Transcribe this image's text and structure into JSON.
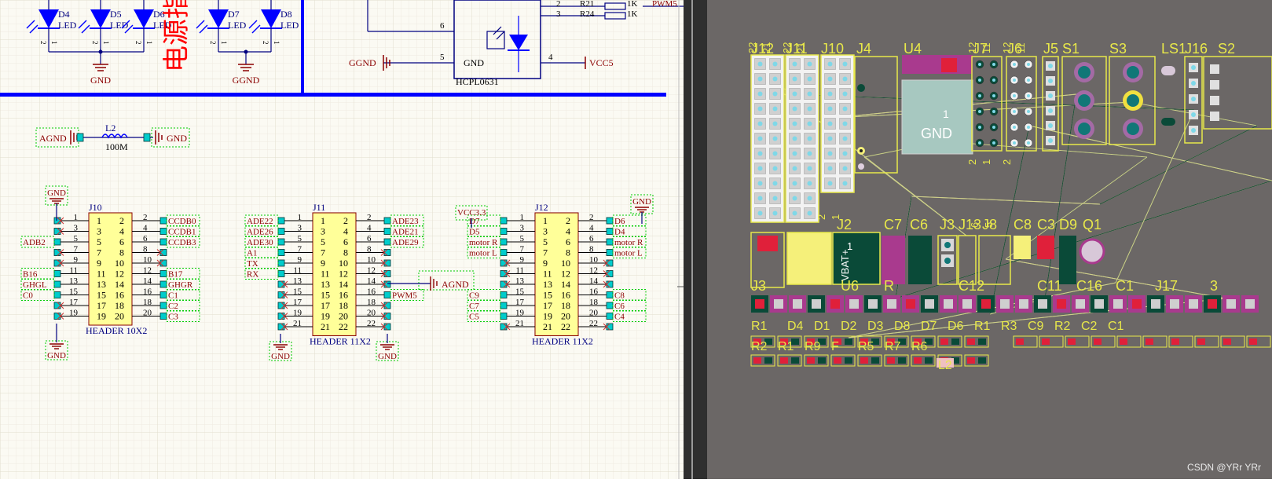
{
  "schematic": {
    "leds": [
      {
        "ref": "D4",
        "val": "LED"
      },
      {
        "ref": "D5",
        "val": "LED"
      },
      {
        "ref": "D6",
        "val": "LED"
      },
      {
        "ref": "D7",
        "val": "LED"
      },
      {
        "ref": "D8",
        "val": "LED"
      }
    ],
    "gnd_label_left": "GND",
    "ggnd_label_left": "GGND",
    "chinese_title": "电源指",
    "optocoupler": {
      "part": "HCPL0631",
      "pin6": "6",
      "pin5": "5",
      "pin4": "4",
      "pin2": "2",
      "pin3": "3",
      "gnd_pin": "GND",
      "ggnd_port": "GGND",
      "vcc_port": "VCC5",
      "r21": "R21",
      "r24": "R24",
      "r21_val": "1K",
      "r24_val": "1K",
      "pwm_net": "PWM5"
    },
    "inductor": {
      "ref": "L2",
      "val": "100M",
      "left_port": "AGND",
      "right_port": "GND"
    },
    "j10": {
      "ref": "J10",
      "footprint": "HEADER 10X2",
      "left_pins": [
        "1",
        "3",
        "5",
        "7",
        "9",
        "11",
        "13",
        "15",
        "17",
        "19"
      ],
      "right_pins": [
        "2",
        "4",
        "6",
        "8",
        "10",
        "12",
        "14",
        "16",
        "18",
        "20"
      ],
      "left_nets": [
        "",
        "",
        "ADB2",
        "",
        "",
        "B16",
        "GHGL",
        "C0",
        "",
        ""
      ],
      "right_nets": [
        "CCDB0",
        "CCDB1",
        "CCDB3",
        "",
        "",
        "B17",
        "GHGR",
        "C1",
        "C2",
        "C3"
      ],
      "top_port": "GND",
      "bottom_port": "GND"
    },
    "j11": {
      "ref": "J11",
      "footprint": "HEADER 11X2",
      "left_pins": [
        "1",
        "3",
        "5",
        "7",
        "9",
        "11",
        "13",
        "15",
        "17",
        "19",
        "21"
      ],
      "right_pins": [
        "2",
        "4",
        "6",
        "8",
        "10",
        "12",
        "14",
        "16",
        "18",
        "20",
        "22"
      ],
      "left_nets": [
        "ADE22",
        "ADE26",
        "ADE30",
        "A1",
        "TX",
        "RX",
        "",
        "",
        "",
        "",
        ""
      ],
      "right_nets": [
        "ADE23",
        "ADE21",
        "ADE29",
        "",
        "",
        "",
        "",
        "PWM5",
        "",
        "",
        ""
      ],
      "right_port": "AGND",
      "bottom_left_port": "GND",
      "bottom_right_port": "GND"
    },
    "j12": {
      "ref": "J12",
      "footprint": "HEADER 11X2",
      "left_pins": [
        "1",
        "3",
        "5",
        "7",
        "9",
        "11",
        "13",
        "15",
        "17",
        "19",
        "21"
      ],
      "right_pins": [
        "2",
        "4",
        "6",
        "8",
        "10",
        "12",
        "14",
        "16",
        "18",
        "20",
        "22"
      ],
      "left_nets": [
        "D7",
        "D5",
        "motor R",
        "motor L",
        "",
        "",
        "",
        "C9",
        "C7",
        "C5",
        ""
      ],
      "right_nets": [
        "D6",
        "D4",
        "motor R",
        "motor L",
        "",
        "",
        "",
        "C8",
        "C6",
        "C4",
        ""
      ],
      "top_left_port": "VCC3.3",
      "top_right_port": "GND"
    }
  },
  "pcb": {
    "top_labels": [
      "J12",
      "J11",
      "J10",
      "J4",
      "U4",
      "J7",
      "J6",
      "J5",
      "S1",
      "S3",
      "LS1",
      "J16",
      "S2"
    ],
    "small_pin_labels": [
      "22",
      "21",
      "22",
      "21",
      "12",
      "11",
      "12",
      "11",
      "2",
      "1",
      "2",
      "1",
      "2",
      "6",
      "5"
    ],
    "mid_labels": [
      "J2",
      "C7",
      "C6",
      "J3",
      "J13",
      "J8",
      "C8",
      "C3",
      "D9",
      "Q1"
    ],
    "row_labels": [
      "J3",
      "U6",
      "R",
      "C12",
      "C11",
      "C16",
      "C1",
      "J17",
      "3"
    ],
    "lower_labels": [
      "R1",
      "D4",
      "D1",
      "D2",
      "D3",
      "D8",
      "D7",
      "D6",
      "R1",
      "R3",
      "C9",
      "R2",
      "C2",
      "C1",
      "R2",
      "R1",
      "R9",
      "F",
      "R5",
      "R7",
      "R6",
      "L2"
    ],
    "u4_text": "GND",
    "j2_text": "VBAT+",
    "j2_pin": "1",
    "u4_pin": "1",
    "u6_text": "1"
  },
  "watermark": "CSDN @YRr YRr"
}
